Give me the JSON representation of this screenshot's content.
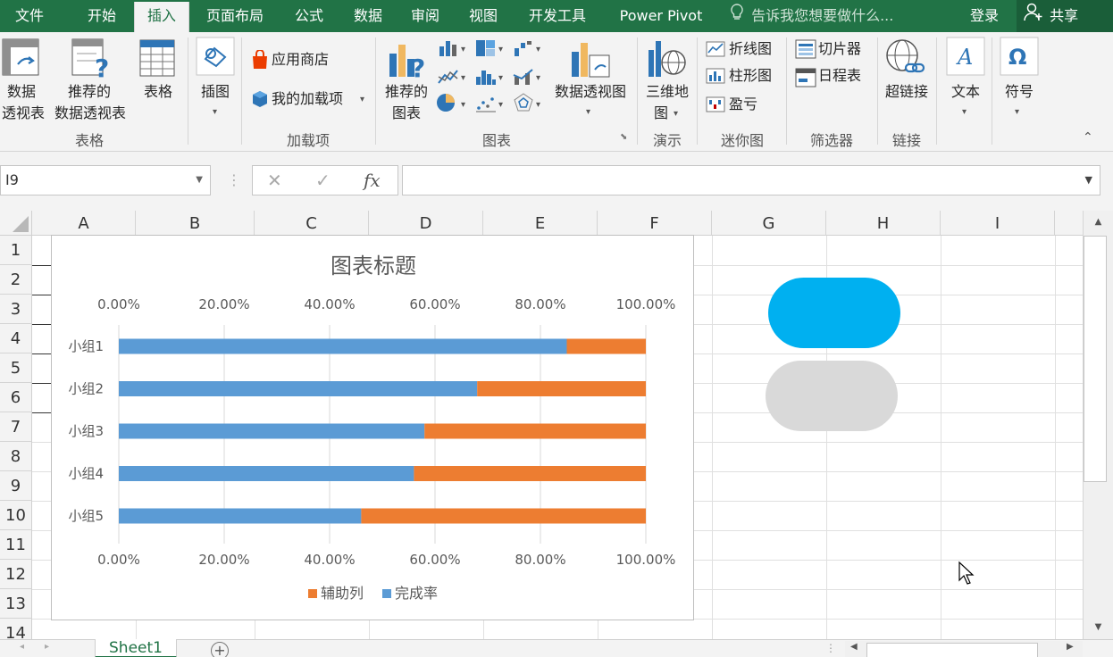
{
  "tabs": {
    "file": "文件",
    "home": "开始",
    "insert": "插入",
    "layout": "页面布局",
    "formula": "公式",
    "data": "数据",
    "review": "审阅",
    "view": "视图",
    "developer": "开发工具",
    "powerpivot": "Power Pivot"
  },
  "tell_me": "告诉我您想要做什么...",
  "login": "登录",
  "share": "共享",
  "ribbon": {
    "pivot_line1": "数据",
    "pivot_line2": "透视表",
    "rec_pivot_line1": "推荐的",
    "rec_pivot_line2": "数据透视表",
    "table": "表格",
    "group_tables": "表格",
    "illustrations": "插图",
    "app_store": "应用商店",
    "my_addins": "我的加载项",
    "group_addins": "加载项",
    "rec_charts_line1": "推荐的",
    "rec_charts_line2": "图表",
    "pivot_chart": "数据透视图",
    "group_charts": "图表",
    "map3d_line1": "三维地",
    "map3d_line2": "图",
    "group_tours": "演示",
    "spark_line": "折线图",
    "spark_column": "柱形图",
    "spark_winloss": "盈亏",
    "group_sparklines": "迷你图",
    "slicer": "切片器",
    "timeline": "日程表",
    "group_filters": "筛选器",
    "hyperlink": "超链接",
    "group_links": "链接",
    "text": "文本",
    "symbol": "符号"
  },
  "namebox": "I9",
  "formula": "",
  "columns": [
    "A",
    "B",
    "C",
    "D",
    "E",
    "F",
    "G",
    "H",
    "I"
  ],
  "rows": [
    "1",
    "2",
    "3",
    "4",
    "5",
    "6",
    "7",
    "8",
    "9",
    "10",
    "11",
    "12",
    "13",
    "14"
  ],
  "sheet_tab": "Sheet1",
  "colors": {
    "excel_green": "#217346",
    "complete": "#5b9bd5",
    "helper": "#ed7d31",
    "pill_blue": "#00b0f0",
    "pill_grey": "#d9d9d9"
  },
  "chart_data": {
    "type": "bar",
    "orientation": "horizontal",
    "stacked": true,
    "title": "图表标题",
    "categories": [
      "小组1",
      "小组2",
      "小组3",
      "小组4",
      "小组5"
    ],
    "series": [
      {
        "name": "完成率",
        "values": [
          0.85,
          0.68,
          0.58,
          0.56,
          0.46
        ]
      },
      {
        "name": "辅助列",
        "values": [
          0.15,
          0.32,
          0.42,
          0.44,
          0.54
        ]
      }
    ],
    "xlim": [
      0,
      1
    ],
    "ticks": [
      "0.00%",
      "20.00%",
      "40.00%",
      "60.00%",
      "80.00%",
      "100.00%"
    ],
    "axis_position": "top and bottom",
    "legend_items": [
      "辅助列",
      "完成率"
    ],
    "legend_position": "bottom",
    "grid": true
  }
}
